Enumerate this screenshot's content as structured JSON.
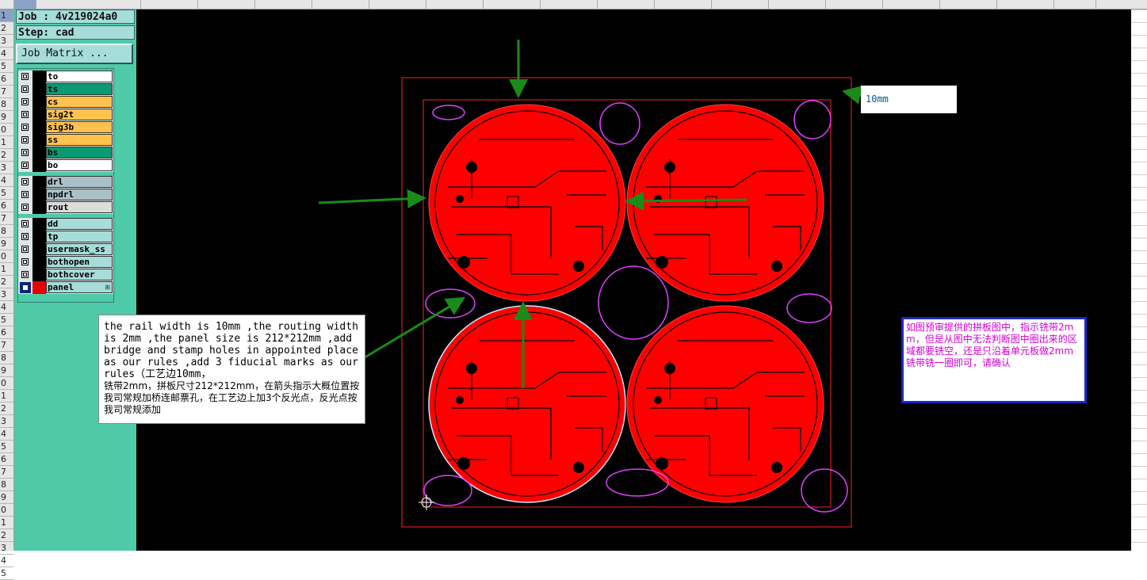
{
  "job": {
    "job_line": "Job : 4v219024a0",
    "step_line": "Step: cad"
  },
  "job_matrix_button": "Job Matrix ...",
  "layer_groups": [
    {
      "layers": [
        {
          "name": "to",
          "color": "#ffffff"
        },
        {
          "name": "ts",
          "color": "#0b9a72"
        },
        {
          "name": "cs",
          "color": "#ffc34d"
        },
        {
          "name": "sig2t",
          "color": "#ffc34d"
        },
        {
          "name": "sig3b",
          "color": "#ffc34d"
        },
        {
          "name": "ss",
          "color": "#ffc34d"
        },
        {
          "name": "bs",
          "color": "#0b9a72"
        },
        {
          "name": "bo",
          "color": "#ffffff"
        }
      ]
    },
    {
      "layers": [
        {
          "name": "drl",
          "color": "#a9c0c8"
        },
        {
          "name": "npdrl",
          "color": "#a9c0c8"
        },
        {
          "name": "rout",
          "color": "#dcdcdc"
        }
      ]
    },
    {
      "layers": [
        {
          "name": "dd",
          "color": "#a6dcd9"
        },
        {
          "name": "tp",
          "color": "#a6dcd9"
        },
        {
          "name": "usermask_ss",
          "color": "#a6dcd9"
        },
        {
          "name": "bothopen",
          "color": "#a6dcd9"
        },
        {
          "name": "bothcover",
          "color": "#a6dcd9"
        },
        {
          "name": "panel",
          "color": "#a6dcd9",
          "active": true
        }
      ]
    }
  ],
  "row_numbers": [
    "1",
    "2",
    "3",
    "4",
    "5",
    "6",
    "7",
    "8",
    "9",
    "0",
    "1",
    "2",
    "3",
    "4",
    "5",
    "6",
    "7",
    "8",
    "9",
    "0",
    "1",
    "2",
    "3",
    "4",
    "5",
    "6",
    "7",
    "8",
    "9",
    "0",
    "1",
    "2",
    "3",
    "4",
    "5",
    "6",
    "7",
    "8",
    "9",
    "0",
    "1",
    "2",
    "3",
    "4",
    "5"
  ],
  "annotations": {
    "rail_note_en": "the rail width is 10mm ,the routing width is 2mm ,the panel size is 212*212mm ,add bridge and stamp holes in appointed place as our rules ,add  3 fiducial marks as our rules（工艺边10mm，",
    "rail_note_zh": "铣带2mm，拼板尺寸212*212mm，在箭头指示大概位置按我司常规加桥连邮票孔，在工艺边上加3个反光点，反光点按我司常规添加",
    "rail_label": "10mm",
    "confirm_note": "如图预审提供的拼板图中，指示铣带2mm，但是从图中无法判断图中圈出来的区域都要铣空，还是只沿着单元板做2mm铣带铣一圈即可，请确认"
  },
  "colors": {
    "board_fill": "#ff0000",
    "outline": "#ff2020",
    "marker": "#e040ff",
    "arrow": "#1a8a1a",
    "sidebar": "#4fcaa8"
  }
}
